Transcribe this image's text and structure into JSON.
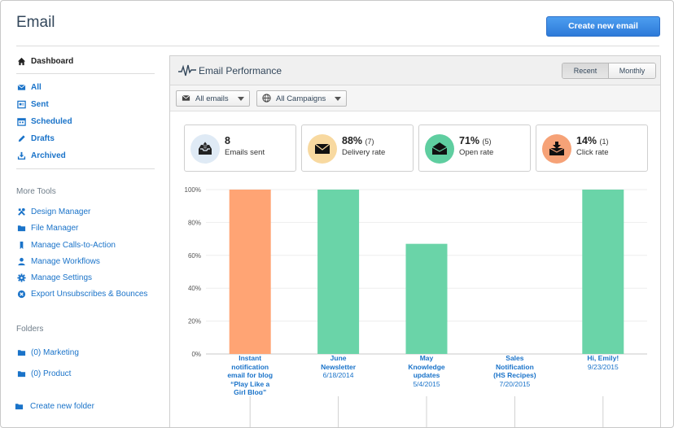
{
  "page": {
    "title": "Email",
    "create_button": "Create new email"
  },
  "sidebar": {
    "dashboard": "Dashboard",
    "nav": [
      {
        "label": "All",
        "icon": "envelope-icon"
      },
      {
        "label": "Sent",
        "icon": "sent-icon"
      },
      {
        "label": "Scheduled",
        "icon": "calendar-icon"
      },
      {
        "label": "Drafts",
        "icon": "pencil-icon"
      },
      {
        "label": "Archived",
        "icon": "archive-icon"
      }
    ],
    "more_tools_heading": "More Tools",
    "tools": [
      {
        "label": "Design Manager",
        "icon": "tools-icon"
      },
      {
        "label": "File Manager",
        "icon": "folder-icon"
      },
      {
        "label": "Manage Calls-to-Action",
        "icon": "bookmark-icon"
      },
      {
        "label": "Manage Workflows",
        "icon": "person-icon"
      },
      {
        "label": "Manage Settings",
        "icon": "gear-icon"
      },
      {
        "label": "Export Unsubscribes & Bounces",
        "icon": "x-circle-icon"
      }
    ],
    "folders_heading": "Folders",
    "folders": [
      {
        "label": "(0) Marketing"
      },
      {
        "label": "(0) Product"
      }
    ],
    "create_folder": "Create new folder"
  },
  "panel": {
    "title": "Email Performance",
    "toggle": {
      "recent": "Recent",
      "monthly": "Monthly",
      "active": "Recent"
    },
    "filters": {
      "emails": "All emails",
      "campaigns": "All Campaigns"
    },
    "stats": [
      {
        "value": "8",
        "sub": "",
        "label": "Emails sent",
        "color": "#dfeaf5",
        "icon": "inbox-upload-icon"
      },
      {
        "value": "88%",
        "sub": "(7)",
        "label": "Delivery rate",
        "color": "#f8d9a0",
        "icon": "envelope-icon"
      },
      {
        "value": "71%",
        "sub": "(5)",
        "label": "Open rate",
        "color": "#5fcea0",
        "icon": "open-envelope-icon"
      },
      {
        "value": "14%",
        "sub": "(1)",
        "label": "Click rate",
        "color": "#f6a277",
        "icon": "download-envelope-icon"
      }
    ]
  },
  "chart_data": {
    "type": "bar",
    "yticks": [
      "100%",
      "80%",
      "60%",
      "40%",
      "20%",
      "0%"
    ],
    "ylim": [
      0,
      100
    ],
    "categories": [
      {
        "name": [
          "Instant",
          "notification",
          "email for blog",
          "“Play Like a",
          "Girl Blog”"
        ],
        "date": ""
      },
      {
        "name": [
          "June",
          "Newsletter"
        ],
        "date": "6/18/2014"
      },
      {
        "name": [
          "May",
          "Knowledge",
          "updates"
        ],
        "date": "5/4/2015"
      },
      {
        "name": [
          "Sales",
          "Notification",
          "(HS Recipes)"
        ],
        "date": "7/20/2015"
      },
      {
        "name": [
          "Hi, Emily!"
        ],
        "date": "9/23/2015"
      }
    ],
    "values": [
      100,
      100,
      67,
      0,
      100
    ],
    "colors": [
      "#ffa474",
      "#6ad4a8",
      "#6ad4a8",
      "#6ad4a8",
      "#6ad4a8"
    ],
    "grid": true
  }
}
